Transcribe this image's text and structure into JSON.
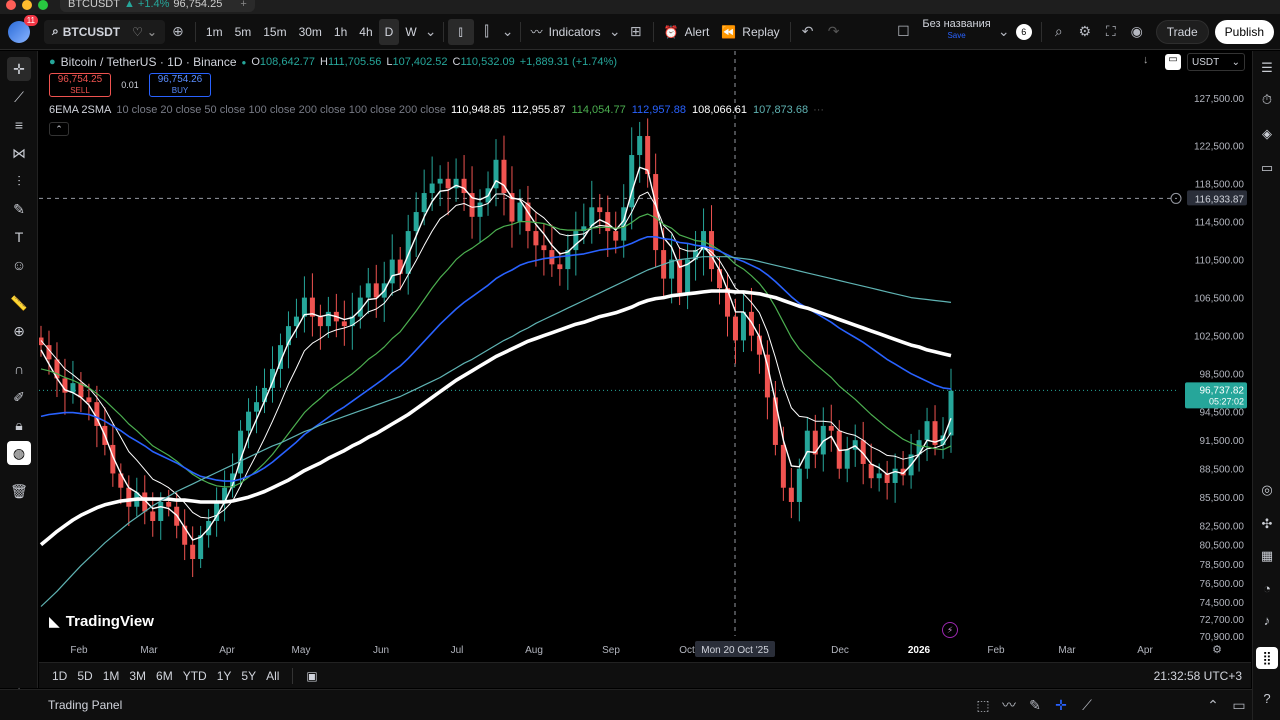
{
  "browser": {
    "tab_title": "96,754.25",
    "tab_symbol": "BTCUSDT",
    "tab_change": "▲ +1.4%"
  },
  "toolbar": {
    "symbol": "BTCUSDT",
    "avatar_badge": "11",
    "timeframes": [
      "1m",
      "5m",
      "15m",
      "30m",
      "1h",
      "4h",
      "D",
      "W"
    ],
    "active_timeframe": "D",
    "indicators_label": "Indicators",
    "alert_label": "Alert",
    "replay_label": "Replay",
    "layout_name": "Без названия",
    "layout_status": "Save",
    "layout_count": "6",
    "trade_label": "Trade",
    "publish_label": "Publish"
  },
  "legend": {
    "title": "Bitcoin / TetherUS · 1D · Binance",
    "open_label": "O",
    "open": "108,642.77",
    "high_label": "H",
    "high": "111,705.56",
    "low_label": "L",
    "low": "107,402.52",
    "close_label": "C",
    "close": "110,532.09",
    "change": "+1,889.31 (+1.74%)",
    "sell_price": "96,754.25",
    "sell_label": "SELL",
    "spread": "0.01",
    "buy_price": "96,754.26",
    "buy_label": "BUY",
    "indicator_name": "6EMA 2SMA",
    "indicator_params": "10 close 20 close 50 close 100 close 200 close 100 close 200 close",
    "indicator_values": [
      {
        "value": "110,948.85",
        "color": "#ffffff"
      },
      {
        "value": "112,955.87",
        "color": "#ffffff"
      },
      {
        "value": "114,054.77",
        "color": "#4caf50"
      },
      {
        "value": "112,957.88",
        "color": "#2962ff"
      },
      {
        "value": "108,066.61",
        "color": "#ffffff"
      },
      {
        "value": "107,873.68",
        "color": "#5fb3b3"
      }
    ]
  },
  "chart_data": {
    "type": "line",
    "title": "Bitcoin / TetherUS · 1D · Binance",
    "x_ticks": [
      "Feb",
      "Mar",
      "Apr",
      "May",
      "Jun",
      "Jul",
      "Aug",
      "Sep",
      "Oct",
      "Dec",
      "2026",
      "Feb",
      "Mar",
      "Apr"
    ],
    "y_ticks": [
      127500,
      122500,
      118500,
      114500,
      110500,
      106500,
      102500,
      98500,
      94500,
      91500,
      88500,
      85500,
      82500,
      80500,
      78500,
      76500,
      74500,
      72700,
      70900
    ],
    "ylim": [
      70000,
      130000
    ],
    "crosshair_date": "Mon 20 Oct '25",
    "crosshair_price": "116,933.87",
    "last_price": "96,737.82",
    "countdown": "05:27:02",
    "currency": "USDT",
    "grid": false,
    "candles_close": [
      101500,
      100000,
      98000,
      96500,
      97500,
      96000,
      95500,
      93000,
      91000,
      88000,
      86500,
      84500,
      86000,
      84000,
      83000,
      85000,
      84500,
      82500,
      80500,
      79000,
      81500,
      83000,
      85000,
      86500,
      88000,
      92500,
      94500,
      95500,
      97000,
      99000,
      101500,
      103500,
      104500,
      106500,
      104500,
      103500,
      105000,
      104000,
      103500,
      104500,
      106500,
      108000,
      106500,
      108000,
      110500,
      109000,
      113500,
      115500,
      117500,
      118500,
      119000,
      118000,
      119000,
      117500,
      115000,
      116500,
      118000,
      121000,
      117500,
      114500,
      116500,
      113500,
      112000,
      111500,
      110000,
      109500,
      111500,
      113500,
      114000,
      116000,
      115500,
      113500,
      112500,
      116000,
      121500,
      123500,
      119500,
      111500,
      108500,
      110500,
      107000,
      110500,
      111500,
      113500,
      109500,
      107500,
      104500,
      102000,
      105000,
      102500,
      100500,
      96000,
      91000,
      86500,
      85000,
      88500,
      92500,
      90000,
      93000,
      92500,
      88500,
      90500,
      91500,
      89000,
      87500,
      88000,
      87000,
      88500,
      87800,
      90000,
      91500,
      93500,
      91000,
      92000,
      96700
    ],
    "series": [
      {
        "name": "EMA 10",
        "color": "#ffffff",
        "width": 1.4,
        "values": [
          101000,
          99500,
          98000,
          96800,
          96500,
          96000,
          95200,
          93800,
          92000,
          89800,
          88000,
          86500,
          86000,
          85200,
          84300,
          84500,
          84300,
          83600,
          82300,
          81000,
          81300,
          82200,
          83500,
          85000,
          86800,
          89500,
          91800,
          93700,
          95600,
          97600,
          99800,
          101800,
          103200,
          104700,
          104800,
          104500,
          104700,
          104500,
          104200,
          104400,
          105200,
          106300,
          106400,
          107200,
          108800,
          109000,
          111000,
          113000,
          115000,
          116600,
          117700,
          117800,
          118300,
          118000,
          117000,
          116800,
          117200,
          118800,
          118300,
          117000,
          116800,
          115500,
          114200,
          113200,
          112000,
          111100,
          111300,
          112100,
          112800,
          114100,
          114700,
          114300,
          113600,
          114600,
          117600,
          120200,
          119900,
          116400,
          112800,
          111800,
          109700,
          110000,
          110600,
          111900,
          110900,
          109400,
          107300,
          105000,
          105000,
          103900,
          102400,
          99400,
          95600,
          91500,
          88800,
          88700,
          90300,
          90200,
          91400,
          91900,
          90400,
          90500,
          90900,
          90100,
          89000,
          88600,
          87900,
          88200,
          88000,
          88900,
          90000,
          91500,
          91300,
          91600,
          93800
        ]
      },
      {
        "name": "EMA 20",
        "color": "#ffffff",
        "width": 1.0,
        "values": [
          102000,
          101000,
          100000,
          99000,
          98400,
          97700,
          97000,
          96000,
          94800,
          93300,
          91800,
          90300,
          89400,
          88400,
          87400,
          87000,
          86500,
          85800,
          84900,
          83900,
          83400,
          83300,
          83600,
          84200,
          85100,
          86700,
          88400,
          90000,
          91700,
          93500,
          95400,
          97400,
          99100,
          100900,
          101700,
          102200,
          102800,
          103100,
          103300,
          103600,
          104200,
          105000,
          105300,
          105900,
          107000,
          107400,
          108900,
          110400,
          112000,
          113500,
          114800,
          115400,
          116200,
          116400,
          116000,
          116100,
          116400,
          117400,
          117400,
          116900,
          116900,
          116300,
          115500,
          114900,
          114000,
          113200,
          113000,
          113100,
          113200,
          113800,
          114100,
          114000,
          113700,
          114000,
          115500,
          117200,
          117600,
          116200,
          114100,
          113300,
          111700,
          111400,
          111400,
          111900,
          111300,
          110400,
          109000,
          107500,
          106900,
          106000,
          104900,
          102900,
          100200,
          97200,
          94900,
          94000,
          93900,
          93500,
          93500,
          93400,
          92500,
          92200,
          92000,
          91500,
          90800,
          90400,
          89900,
          89800,
          89500,
          89700,
          90000,
          90600,
          90700,
          91000,
          92300
        ]
      },
      {
        "name": "EMA 50",
        "color": "#4caf50",
        "width": 1.2,
        "values": [
          99000,
          98800,
          98500,
          98100,
          97800,
          97400,
          97000,
          96400,
          95700,
          94900,
          94100,
          93200,
          92500,
          91700,
          90900,
          90400,
          89900,
          89300,
          88600,
          87900,
          87400,
          87000,
          86700,
          86600,
          86600,
          87000,
          87600,
          88300,
          89100,
          90000,
          91100,
          92200,
          93300,
          94400,
          95200,
          95900,
          96700,
          97300,
          97900,
          98500,
          99200,
          100000,
          100600,
          101300,
          102200,
          102900,
          104000,
          105100,
          106300,
          107500,
          108600,
          109500,
          110500,
          111200,
          111700,
          112300,
          112900,
          113600,
          114000,
          114200,
          114500,
          114500,
          114400,
          114300,
          114000,
          113700,
          113600,
          113600,
          113600,
          113800,
          113900,
          113900,
          113800,
          113900,
          114400,
          115000,
          115300,
          114900,
          114200,
          113800,
          113100,
          112800,
          112500,
          112400,
          112000,
          111500,
          110800,
          110000,
          109500,
          108800,
          108000,
          106900,
          105500,
          103900,
          102300,
          101100,
          100300,
          99500,
          98800,
          98100,
          97200,
          96500,
          95800,
          95000,
          94200,
          93500,
          92800,
          92200,
          91600,
          91200,
          90900,
          90800,
          90600,
          90500,
          90900
        ]
      },
      {
        "name": "EMA 100",
        "color": "#2962ff",
        "width": 1.6,
        "values": [
          94000,
          94200,
          94300,
          94400,
          94400,
          94300,
          94200,
          93900,
          93500,
          93000,
          92500,
          91900,
          91400,
          90900,
          90300,
          89900,
          89500,
          89100,
          88600,
          88100,
          87700,
          87500,
          87300,
          87200,
          87200,
          87400,
          87700,
          88100,
          88600,
          89200,
          89900,
          90600,
          91300,
          92100,
          92700,
          93300,
          93900,
          94500,
          95000,
          95600,
          96200,
          96800,
          97400,
          98000,
          98700,
          99300,
          100100,
          101000,
          101900,
          102800,
          103700,
          104500,
          105300,
          106000,
          106600,
          107200,
          107800,
          108500,
          109000,
          109400,
          109900,
          110200,
          110400,
          110600,
          110700,
          110800,
          110900,
          111000,
          111100,
          111300,
          111500,
          111600,
          111700,
          111900,
          112200,
          112600,
          112900,
          112900,
          112700,
          112600,
          112300,
          112200,
          112000,
          111900,
          111700,
          111400,
          111000,
          110600,
          110300,
          109900,
          109500,
          108900,
          108200,
          107400,
          106600,
          105900,
          105400,
          104900,
          104400,
          103900,
          103300,
          102800,
          102300,
          101800,
          101200,
          100600,
          100000,
          99500,
          99000,
          98500,
          98100,
          97700,
          97300,
          97000,
          96900
        ]
      },
      {
        "name": "EMA 200",
        "color": "#ffffff",
        "width": 3.6,
        "values": [
          80500,
          81200,
          81900,
          82500,
          83100,
          83600,
          84000,
          84400,
          84700,
          84900,
          85100,
          85200,
          85300,
          85300,
          85300,
          85300,
          85300,
          85200,
          85200,
          85100,
          85000,
          85000,
          85000,
          85000,
          85100,
          85300,
          85500,
          85800,
          86100,
          86500,
          86900,
          87300,
          87800,
          88300,
          88700,
          89100,
          89600,
          90000,
          90400,
          90900,
          91300,
          91800,
          92200,
          92700,
          93200,
          93700,
          94200,
          94800,
          95400,
          96000,
          96600,
          97200,
          97800,
          98300,
          98800,
          99300,
          99800,
          100300,
          100700,
          101100,
          101500,
          101900,
          102200,
          102500,
          102800,
          103100,
          103400,
          103700,
          103900,
          104200,
          104500,
          104700,
          104900,
          105200,
          105500,
          105900,
          106200,
          106400,
          106500,
          106700,
          106800,
          106900,
          107000,
          107100,
          107200,
          107200,
          107200,
          107100,
          107100,
          107000,
          106900,
          106700,
          106500,
          106200,
          105900,
          105600,
          105400,
          105100,
          104800,
          104500,
          104200,
          103900,
          103600,
          103300,
          103000,
          102700,
          102400,
          102100,
          101800,
          101500,
          101300,
          101000,
          100800,
          100600,
          100400
        ]
      },
      {
        "name": "SMA 200",
        "color": "#5fb3b3",
        "width": 1.2,
        "values": [
          74000,
          74800,
          75600,
          76500,
          77400,
          78300,
          79100,
          79900,
          80700,
          81400,
          82100,
          82800,
          83400,
          84000,
          84600,
          85100,
          85600,
          86100,
          86500,
          86900,
          87300,
          87700,
          88100,
          88500,
          88900,
          89300,
          89700,
          90100,
          90500,
          90900,
          91200,
          91600,
          92000,
          92400,
          92700,
          93100,
          93400,
          93700,
          94000,
          94300,
          94600,
          94900,
          95200,
          95500,
          95800,
          96100,
          96500,
          96900,
          97300,
          97700,
          98100,
          98600,
          99100,
          99600,
          100000,
          100500,
          101000,
          101500,
          102000,
          102400,
          102900,
          103300,
          103800,
          104200,
          104600,
          105000,
          105400,
          105800,
          106200,
          106600,
          107000,
          107400,
          107800,
          108200,
          108600,
          109000,
          109400,
          109700,
          110000,
          110300,
          110500,
          110600,
          110700,
          110800,
          110800,
          110800,
          110800,
          110700,
          110600,
          110500,
          110300,
          110100,
          109900,
          109700,
          109500,
          109300,
          109100,
          108900,
          108700,
          108500,
          108300,
          108100,
          107900,
          107700,
          107500,
          107300,
          107100,
          106900,
          106700,
          106500,
          106400,
          106300,
          106200,
          106100,
          106000
        ]
      }
    ]
  },
  "watermark": "TradingView",
  "ranges": [
    "1D",
    "5D",
    "1M",
    "3M",
    "6M",
    "YTD",
    "1Y",
    "5Y",
    "All"
  ],
  "clock": "21:32:58 UTC+3",
  "trading_panel": "Trading Panel",
  "colors": {
    "up": "#26a69a",
    "down": "#ef5350",
    "background": "#000000"
  }
}
